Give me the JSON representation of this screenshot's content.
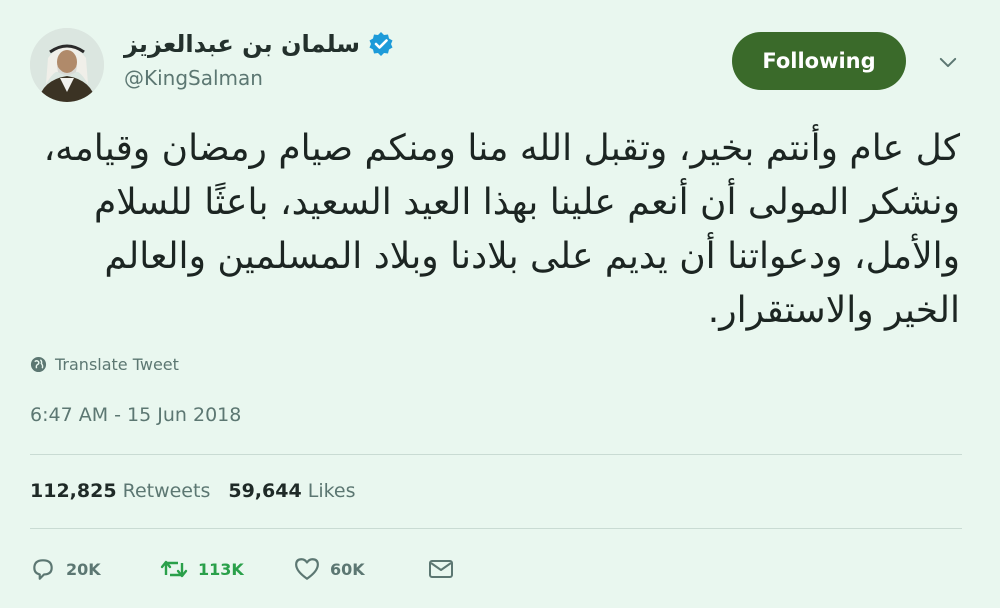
{
  "user": {
    "display_name": "سلمان بن عبدالعزيز",
    "handle": "@KingSalman",
    "verified": true
  },
  "follow_button": {
    "label": "Following",
    "color": "#3a6a2a"
  },
  "tweet": {
    "lines": [
      "كل عام وأنتم بخير، وتقبل الله منا ومنكم صيام رمضان وقيامه،",
      "ونشكر المولى أن أنعم علينا بهذا العيد السعيد، باعثًا للسلام",
      "والأمل، ودعواتنا أن يديم على بلادنا وبلاد المسلمين والعالم",
      "الخير والاستقرار."
    ],
    "translate_label": "Translate Tweet",
    "timestamp": "6:47 AM - 15 Jun 2018"
  },
  "stats": {
    "retweets_count": "112,825",
    "retweets_label": "Retweets",
    "likes_count": "59,644",
    "likes_label": "Likes"
  },
  "actions": {
    "reply_count": "20K",
    "retweet_count": "113K",
    "like_count": "60K",
    "retweet_color": "#2aa04a"
  }
}
